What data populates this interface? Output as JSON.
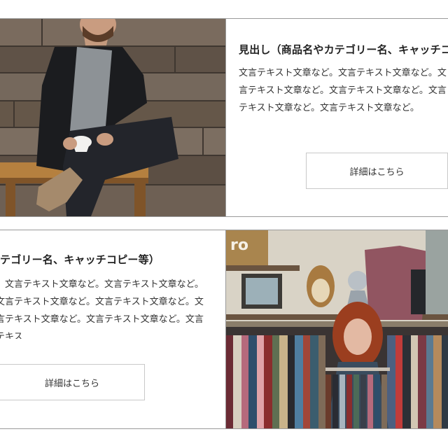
{
  "card1": {
    "heading": "見出し（商品名やカテゴリー名、キャッチコピー等）",
    "body": "文言テキスト文章など。文言テキスト文章など。文言テキスト文章など。文言テキスト文章など。文言テキスト文章など。文言テキスト文章など。",
    "button_label": "詳細はこちら",
    "image": "man-sitting-with-coffee-photo"
  },
  "card2": {
    "heading": "テゴリー名、キャッチコピー等）",
    "body": "、文言テキスト文章など。文言テキスト文章など。文言テキスト文章など。文言テキスト文章など。文言テキスト文章など。文言テキスト文章など。文言テキス",
    "button_label": "詳細はこちら",
    "image": "woman-browsing-clothing-rack-photo"
  },
  "colors": {
    "border": "#9a9a9a",
    "button_border": "#c8c8c8",
    "text": "#222222"
  }
}
